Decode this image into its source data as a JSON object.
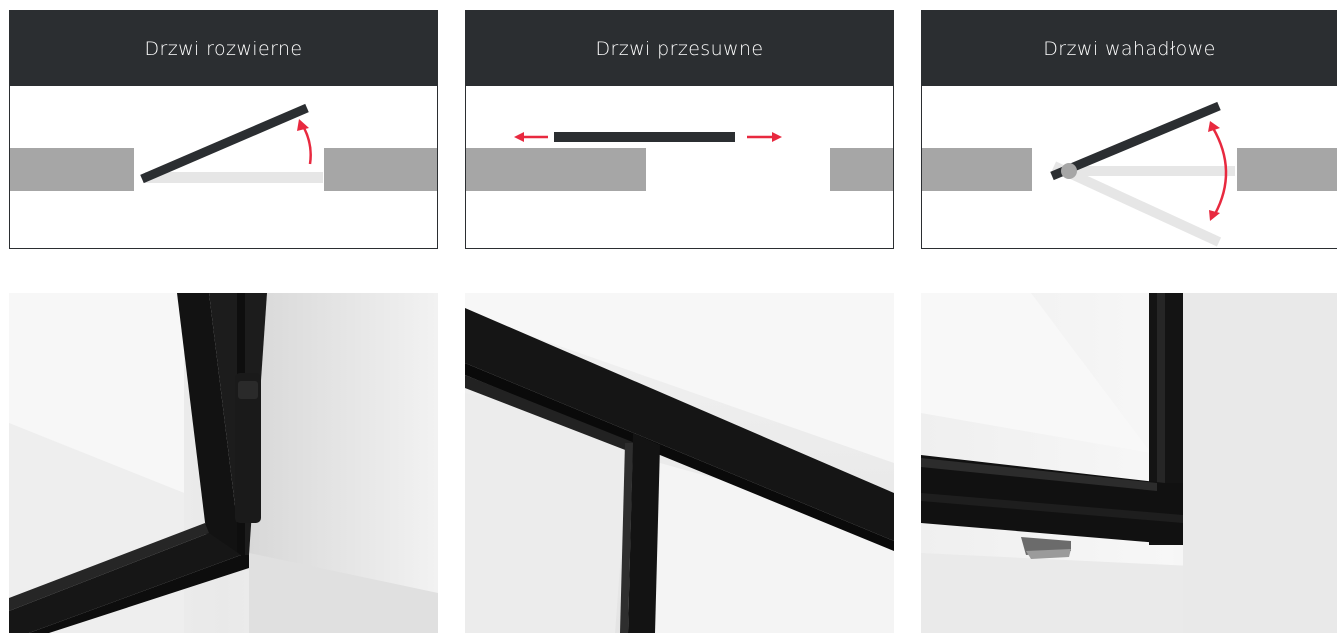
{
  "door_types": [
    {
      "title": "Drzwi rozwierne"
    },
    {
      "title": "Drzwi przesuwne"
    },
    {
      "title": "Drzwi wahadłowe"
    }
  ],
  "colors": {
    "header_bg": "#2b2e31",
    "wall": "#a6a6a6",
    "door_leaf": "#2b2e31",
    "arrow": "#e8293f",
    "door_ghost": "#e6e6e6",
    "pivot": "#a6a6a6"
  },
  "icons": {
    "card1": "swing-door-icon",
    "card2": "sliding-door-icon",
    "card3": "pivot-door-icon",
    "photos": [
      "hinge-detail-photo",
      "sliding-track-detail-photo",
      "pivot-floor-detail-photo"
    ]
  }
}
